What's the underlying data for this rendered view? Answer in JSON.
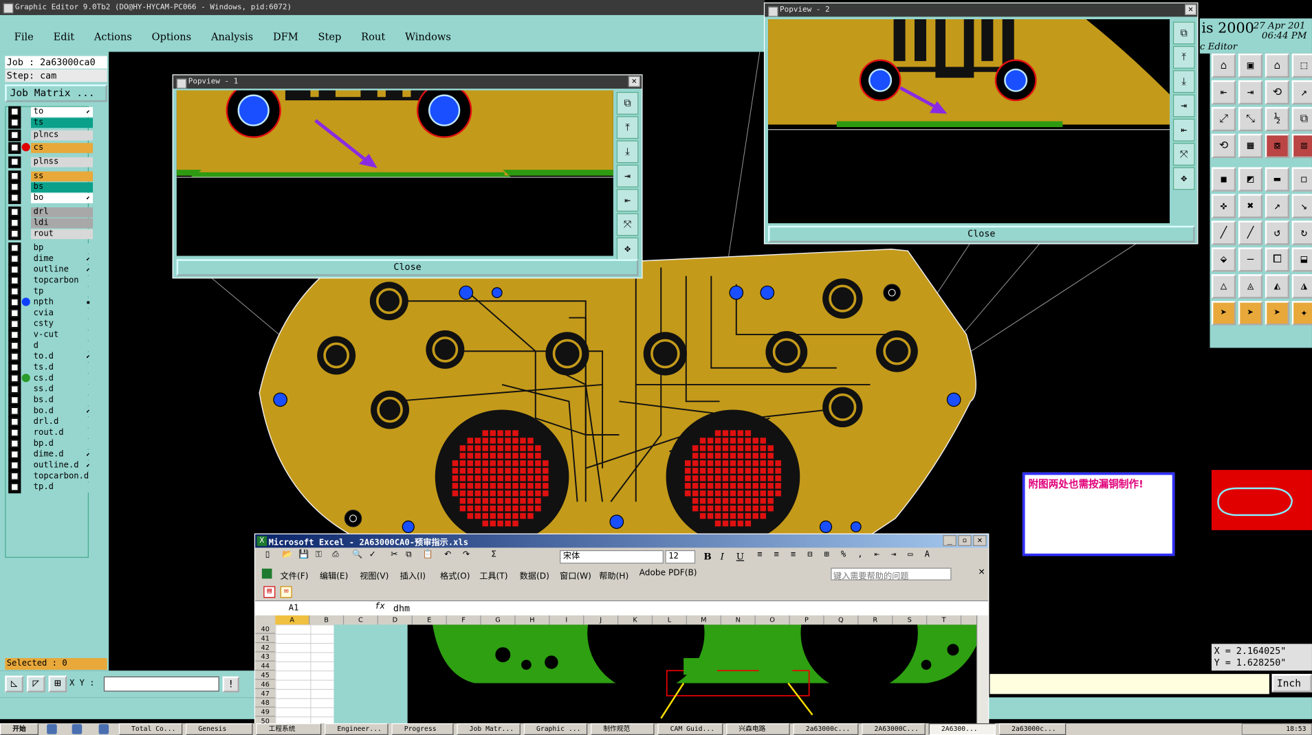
{
  "graphic_editor": {
    "title": "Graphic Editor 9.0Tb2 (DO@HY-HYCAM-PC066 - Windows, pid:6072)",
    "menu": [
      "File",
      "Edit",
      "Actions",
      "Options",
      "Analysis",
      "DFM",
      "Step",
      "Rout",
      "Windows"
    ],
    "job": "Job : 2a63000ca0",
    "step": "Step: cam",
    "job_matrix": "Job Matrix ...",
    "selected": "Selected : 0",
    "xy_label": "X Y :"
  },
  "layers": [
    {
      "name": "to",
      "bg": "#ffffff",
      "mark": "⬋"
    },
    {
      "name": "ts",
      "bg": "#0aa08a"
    },
    {
      "name": "plncs",
      "bg": "#d8d8d8"
    },
    {
      "name": "cs",
      "bg": "#e8a83a",
      "dot": "#e00000"
    },
    {
      "name": "plnss",
      "bg": "#d8d8d8"
    },
    {
      "name": "ss",
      "bg": "#e8a83a"
    },
    {
      "name": "bs",
      "bg": "#0aa08a"
    },
    {
      "name": "bo",
      "bg": "#ffffff",
      "mark": "⬋"
    },
    {
      "name": "drl",
      "bg": "#a8a8a8"
    },
    {
      "name": "ldi",
      "bg": "#a8a8a8"
    },
    {
      "name": "rout",
      "bg": "#d8d8d8"
    },
    {
      "name": "bp",
      "bg": "#96d6cf"
    },
    {
      "name": "dime",
      "bg": "#96d6cf",
      "mark": "⬋"
    },
    {
      "name": "outline",
      "bg": "#96d6cf",
      "mark": "⬋"
    },
    {
      "name": "topcarbon",
      "bg": "#96d6cf"
    },
    {
      "name": "tp",
      "bg": "#96d6cf"
    },
    {
      "name": "npth",
      "bg": "#96d6cf",
      "dot": "#1040ff",
      "mark": "▪"
    },
    {
      "name": "cvia",
      "bg": "#96d6cf"
    },
    {
      "name": "csty",
      "bg": "#96d6cf"
    },
    {
      "name": "v-cut",
      "bg": "#96d6cf"
    },
    {
      "name": "d",
      "bg": "#96d6cf"
    },
    {
      "name": "to.d",
      "bg": "#96d6cf",
      "mark": "⬋"
    },
    {
      "name": "ts.d",
      "bg": "#96d6cf"
    },
    {
      "name": "cs.d",
      "bg": "#96d6cf",
      "dot": "#2a9a2a"
    },
    {
      "name": "ss.d",
      "bg": "#96d6cf"
    },
    {
      "name": "bs.d",
      "bg": "#96d6cf"
    },
    {
      "name": "bo.d",
      "bg": "#96d6cf",
      "mark": "⬋"
    },
    {
      "name": "drl.d",
      "bg": "#96d6cf"
    },
    {
      "name": "rout.d",
      "bg": "#96d6cf"
    },
    {
      "name": "bp.d",
      "bg": "#96d6cf"
    },
    {
      "name": "dime.d",
      "bg": "#96d6cf",
      "mark": "⬋"
    },
    {
      "name": "outline.d",
      "bg": "#96d6cf",
      "mark": "⬋"
    },
    {
      "name": "topcarbon.d",
      "bg": "#96d6cf"
    },
    {
      "name": "tp.d",
      "bg": "#96d6cf"
    }
  ],
  "popview1": {
    "title": "Popview - 1",
    "close": "Close"
  },
  "popview2": {
    "title": "Popview - 2",
    "close": "Close"
  },
  "right_panel": {
    "brand": "is 2000",
    "date": "27 Apr 201",
    "time": "06:44 PM",
    "subtitle": "c Editor",
    "x": "X = 2.164025\"",
    "y": "Y = 1.628250\"",
    "units": "Inch"
  },
  "note_text": "附图两处也需按漏铜制作!",
  "excel": {
    "title": "Microsoft Excel - 2A63000CA0-预审指示.xls",
    "font": "宋体",
    "size": "12",
    "menu": [
      "文件(F)",
      "编辑(E)",
      "视图(V)",
      "插入(I)",
      "格式(O)",
      "工具(T)",
      "数据(D)",
      "窗口(W)",
      "帮助(H)",
      "Adobe PDF(B)"
    ],
    "help_placeholder": "键入需要帮助的问题",
    "cell_ref": "A1",
    "fx": "fx",
    "formula": "dhm",
    "columns": [
      "A",
      "B",
      "C",
      "D",
      "E",
      "F",
      "G",
      "H",
      "I",
      "J",
      "K",
      "L",
      "M",
      "N",
      "O",
      "P",
      "Q",
      "R",
      "S",
      "T"
    ],
    "rows": [
      "40",
      "41",
      "42",
      "43",
      "44",
      "45",
      "46",
      "47",
      "48",
      "49",
      "50"
    ]
  },
  "taskbar": {
    "start": "开始",
    "items": [
      "Total Co...",
      "Genesis",
      "工程系统",
      "Engineer...",
      "Progress",
      "Job Matr...",
      "Graphic ...",
      "制作规范",
      "CAM Guid...",
      "兴森电路",
      "2a63000c...",
      "2A63000C...",
      "2A6300...",
      "2a63000c..."
    ],
    "clock": "18:53"
  }
}
